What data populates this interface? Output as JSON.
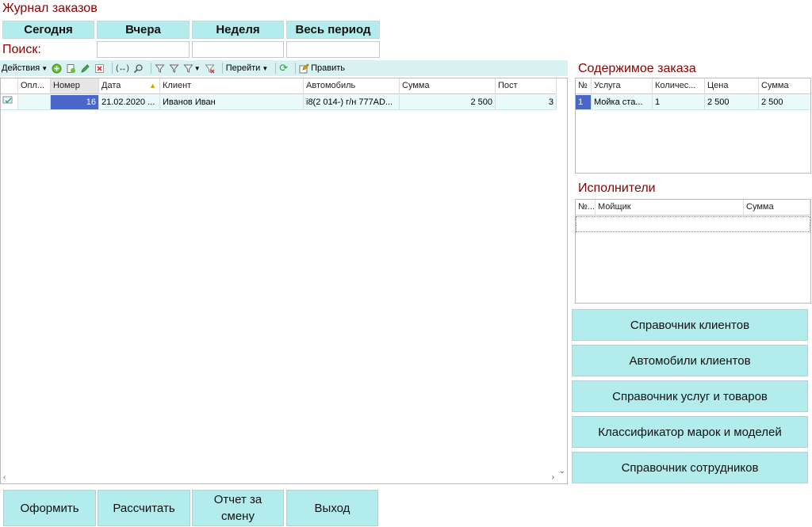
{
  "header": {
    "title": "Журнал заказов"
  },
  "periods": [
    "Сегодня",
    "Вчера",
    "Неделя",
    "Весь период"
  ],
  "search": {
    "label": "Поиск:"
  },
  "toolbar": {
    "actions": "Действия",
    "goto": "Перейти",
    "edit": "Править"
  },
  "orders": {
    "columns": [
      "Опл...",
      "Номер",
      "Дата",
      "Клиент",
      "Автомобиль",
      "Сумма",
      "Пост"
    ],
    "rows": [
      {
        "paid": "",
        "number": "16",
        "date": "21.02.2020 ...",
        "client": "Иванов Иван",
        "car": "i8(2 014-) г/н 777AD...",
        "sum": "2 500",
        "post": "3"
      }
    ]
  },
  "content": {
    "title": "Содержимое заказа",
    "columns": [
      "№",
      "Услуга",
      "Количес...",
      "Цена",
      "Сумма"
    ],
    "rows": [
      {
        "n": "1",
        "service": "Мойка ста...",
        "qty": "1",
        "price": "2 500",
        "sum": "2 500"
      }
    ]
  },
  "executors": {
    "title": "Исполнители",
    "columns": [
      "№...",
      "Мойщик",
      "Сумма"
    ]
  },
  "side_buttons": [
    "Справочник клиентов",
    "Автомобили клиентов",
    "Справочник услуг и товаров",
    "Классификатор марок и моделей",
    "Справочник сотрудников"
  ],
  "bottom_buttons": {
    "issue": "Оформить",
    "calc": "Рассчитать",
    "report_line1": "Отчет за",
    "report_line2": "смену",
    "exit": "Выход"
  },
  "colors": {
    "accent": "#b3eced",
    "title_red": "#8b0000",
    "selection": "#4a66c8"
  }
}
